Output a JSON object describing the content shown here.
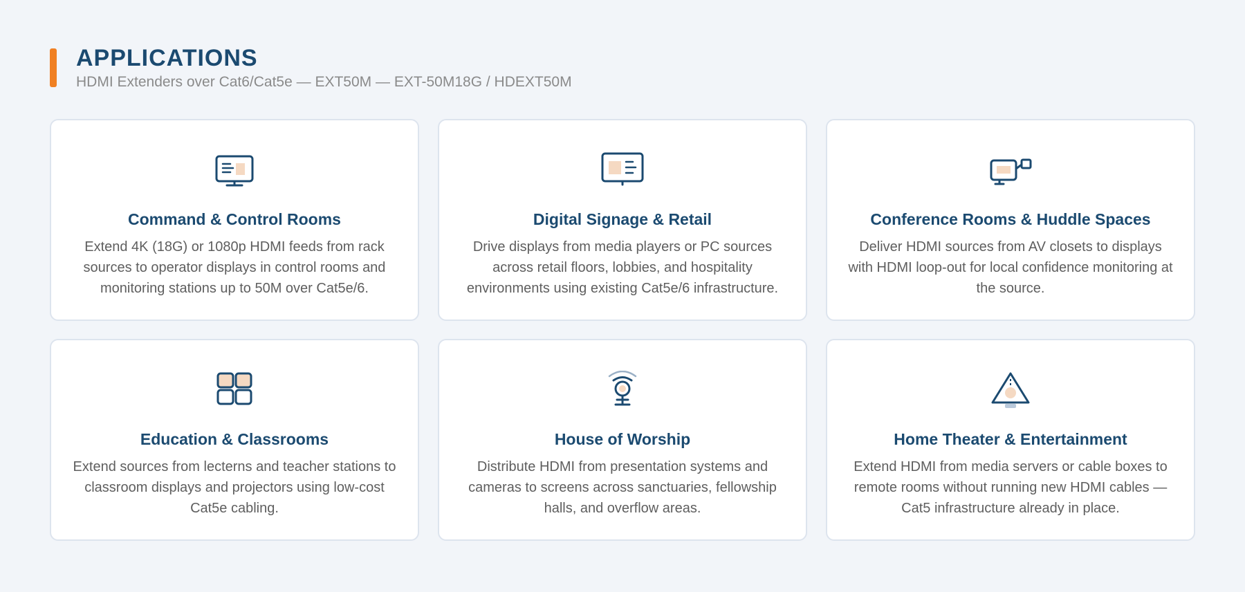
{
  "header": {
    "title": "APPLICATIONS",
    "subtitle": "HDMI Extenders over Cat6/Cat5e — EXT50M — EXT-50M18G / HDEXT50M"
  },
  "colors": {
    "accent": "#f08023",
    "primary": "#1b4a70",
    "icon_fill": "#f5d9c2",
    "text_muted": "#5e5e5e"
  },
  "cards": [
    {
      "icon": "monitor-icon",
      "title": "Command & Control Rooms",
      "description": "Extend 4K (18G) or 1080p HDMI feeds from rack sources to operator displays in control rooms and monitoring stations up to 50M over Cat5e/6."
    },
    {
      "icon": "display-screen-icon",
      "title": "Digital Signage & Retail",
      "description": "Drive displays from media players or PC sources across retail floors, lobbies, and hospitality environments using existing Cat5e/6 infrastructure."
    },
    {
      "icon": "monitor-link-icon",
      "title": "Conference Rooms & Huddle Spaces",
      "description": "Deliver HDMI sources from AV closets to displays with HDMI loop-out for local confidence monitoring at the source."
    },
    {
      "icon": "grid-icon",
      "title": "Education & Classrooms",
      "description": "Extend sources from lecterns and teacher stations to classroom displays and projectors using low-cost Cat5e cabling."
    },
    {
      "icon": "broadcast-camera-icon",
      "title": "House of Worship",
      "description": "Distribute HDMI from presentation systems and cameras to screens across sanctuaries, fellowship halls, and overflow areas."
    },
    {
      "icon": "projector-triangle-icon",
      "title": "Home Theater & Entertainment",
      "description": "Extend HDMI from media servers or cable boxes to remote rooms without running new HDMI cables — Cat5 infrastructure already in place."
    }
  ]
}
